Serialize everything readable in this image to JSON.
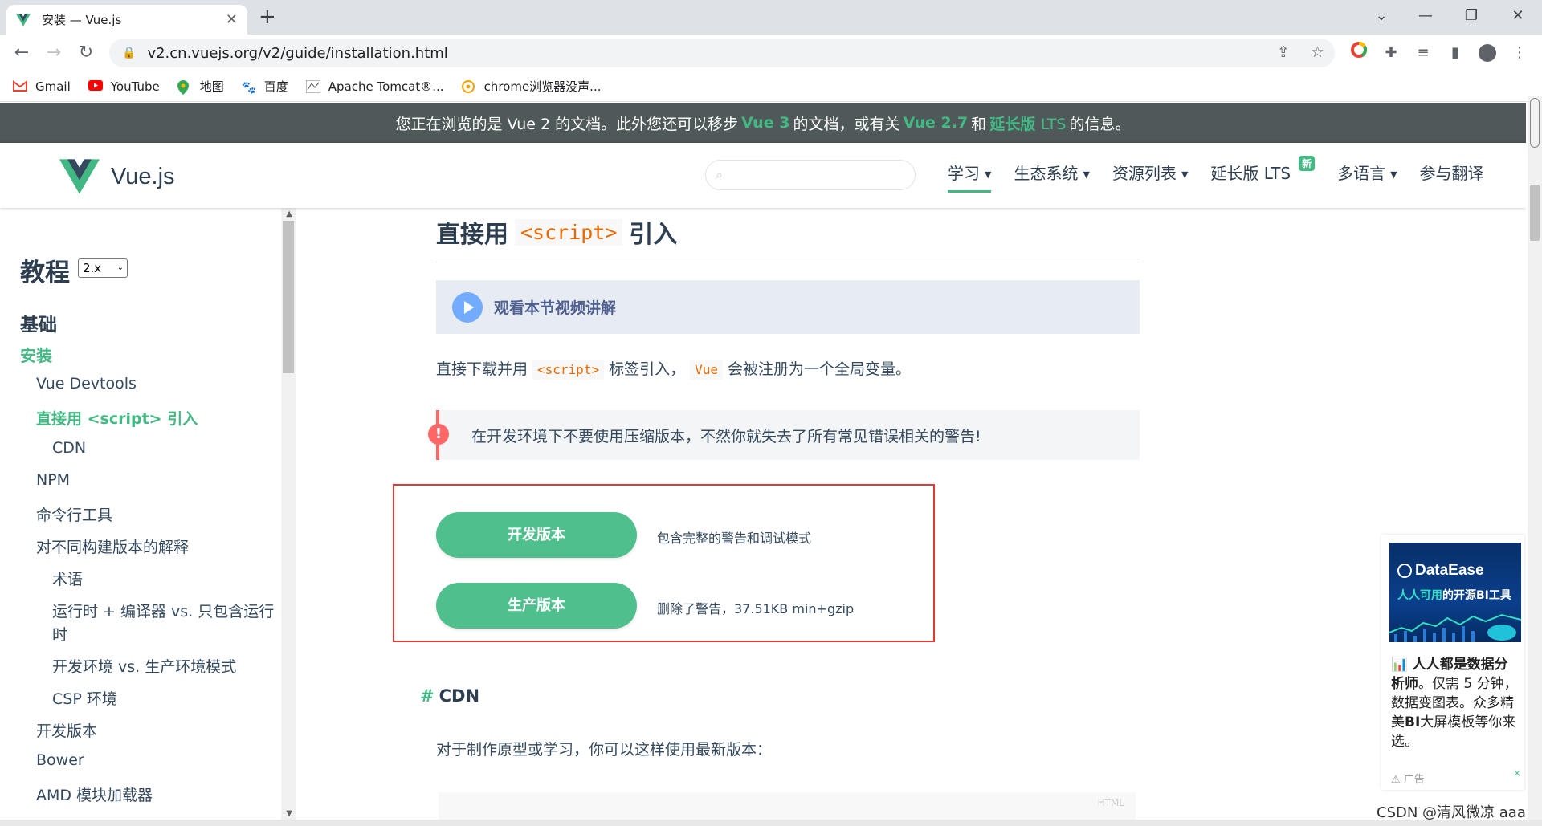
{
  "browser": {
    "tab_title": "安装 — Vue.js",
    "url": "v2.cn.vuejs.org/v2/guide/installation.html",
    "bookmarks": [
      {
        "label": "Gmail",
        "icon": "gmail-icon"
      },
      {
        "label": "YouTube",
        "icon": "youtube-icon"
      },
      {
        "label": "地图",
        "icon": "maps-icon"
      },
      {
        "label": "百度",
        "icon": "baidu-icon"
      },
      {
        "label": "Apache Tomcat®...",
        "icon": "tomcat-icon"
      },
      {
        "label": "chrome浏览器没声...",
        "icon": "chrome-bookmark-icon"
      }
    ]
  },
  "banner": {
    "prefix": "您正在浏览的是 Vue 2 的文档。此外您还可以移步",
    "link1": "Vue 3",
    "mid1": "的文档，或有关",
    "link2": "Vue 2.7",
    "mid2": "和",
    "link3a": "延长版",
    "link3b": "LTS",
    "suffix": "的信息。"
  },
  "header": {
    "logo_text": "Vue.js",
    "nav": [
      {
        "label": "学习",
        "has_caret": true,
        "active": true
      },
      {
        "label": "生态系统",
        "has_caret": true
      },
      {
        "label": "资源列表",
        "has_caret": true
      },
      {
        "label": "延长版 LTS",
        "badge": "新"
      },
      {
        "label": "多语言",
        "has_caret": true
      },
      {
        "label": "参与翻译"
      }
    ]
  },
  "sidebar": {
    "title": "教程",
    "version": "2.x",
    "section": "基础",
    "items": [
      {
        "label": "安装",
        "level": 0,
        "active": true
      },
      {
        "label": "Vue Devtools",
        "level": 1
      },
      {
        "label": "直接用 <script> 引入",
        "level": 1,
        "active": true
      },
      {
        "label": "CDN",
        "level": 2
      },
      {
        "label": "NPM",
        "level": 1
      },
      {
        "label": "命令行工具",
        "level": 1
      },
      {
        "label": "对不同构建版本的解释",
        "level": 1
      },
      {
        "label": "术语",
        "level": 2
      },
      {
        "label": "运行时 + 编译器 vs. 只包含运行",
        "level": 2
      },
      {
        "label": "时",
        "level": 2
      },
      {
        "label": "开发环境 vs. 生产环境模式",
        "level": 2
      },
      {
        "label": "CSP 环境",
        "level": 2
      },
      {
        "label": "开发版本",
        "level": 1
      },
      {
        "label": "Bower",
        "level": 1
      },
      {
        "label": "AMD 模块加载器",
        "level": 1
      }
    ]
  },
  "content": {
    "title_before": "直接用",
    "title_code": "<script>",
    "title_after": "引入",
    "video_label": "观看本节视频讲解",
    "p1_a": "直接下载并用",
    "p1_code1": "<script>",
    "p1_b": "标签引入，",
    "p1_code2": "Vue",
    "p1_c": "会被注册为一个全局变量。",
    "warning": "在开发环境下不要使用压缩版本，不然你就失去了所有常见错误相关的警告!",
    "dev_button": "开发版本",
    "dev_desc": "包含完整的警告和调试模式",
    "prod_button": "生产版本",
    "prod_desc": "删除了警告，37.51KB min+gzip",
    "cdn_hash": "#",
    "cdn_heading": "CDN",
    "cdn_para": "对于制作原型或学习，你可以这样使用最新版本：",
    "code_lang": "HTML"
  },
  "ad": {
    "brand": "DataEase",
    "slogan_a": "人人可用",
    "slogan_b": "的开源BI工具",
    "text_bold1": "人人都是数据分析师",
    "text_1": "。仅需 5 分钟，数据变图表。众多精美",
    "text_bold2": "BI",
    "text_2": "大屏模板等你来选。",
    "footer": "广告",
    "close": "×"
  },
  "watermark": "CSDN @清风微凉 aaa",
  "colors": {
    "accent": "#42b983",
    "banner_bg": "#4f5959",
    "code": "#e96900",
    "warn": "#ff6666",
    "highlight_box": "#e53935"
  }
}
